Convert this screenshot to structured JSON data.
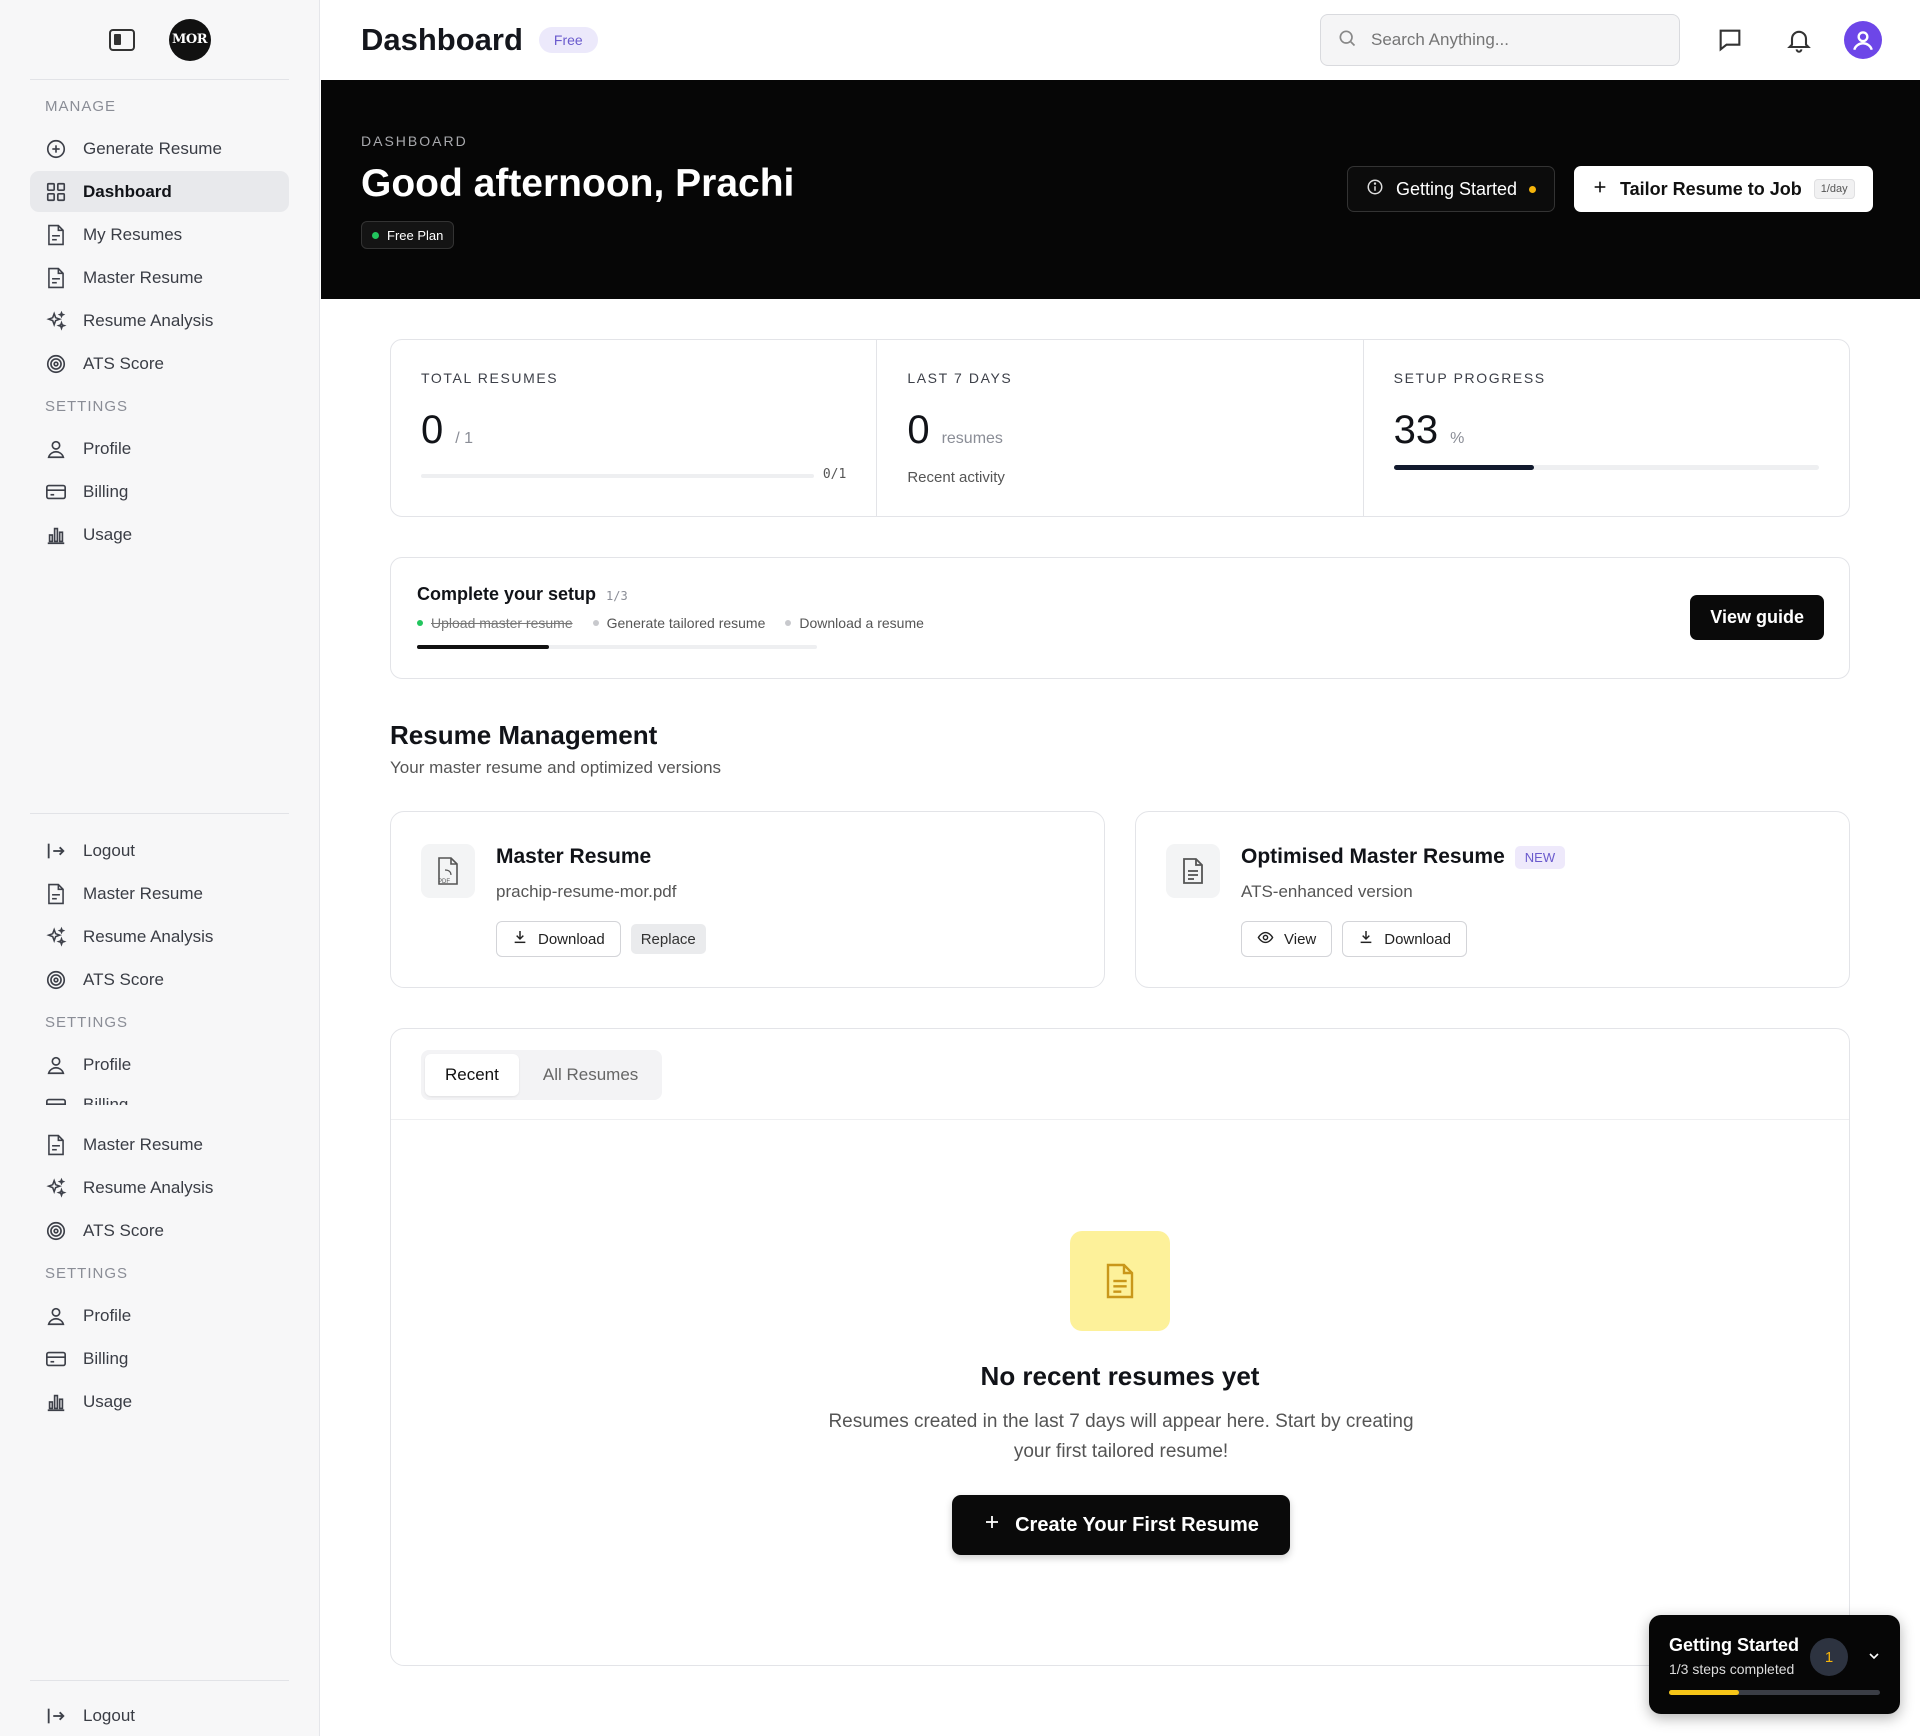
{
  "app": {
    "logo_text": "MOR"
  },
  "sidebar": {
    "groups": [
      {
        "section": "MANAGE",
        "items": [
          {
            "label": "Generate Resume",
            "icon": "plus-circle-icon"
          },
          {
            "label": "Dashboard",
            "icon": "grid-icon",
            "active": true
          },
          {
            "label": "My Resumes",
            "icon": "document-icon"
          },
          {
            "label": "Master Resume",
            "icon": "document-icon"
          },
          {
            "label": "Resume Analysis",
            "icon": "sparkles-icon"
          },
          {
            "label": "ATS Score",
            "icon": "target-icon"
          }
        ]
      },
      {
        "section": "SETTINGS",
        "items": [
          {
            "label": "Profile",
            "icon": "user-icon"
          },
          {
            "label": "Billing",
            "icon": "credit-card-icon"
          },
          {
            "label": "Usage",
            "icon": "bar-chart-icon"
          }
        ]
      }
    ],
    "duplicate_a": [
      {
        "label": "Logout",
        "icon": "logout-icon"
      },
      {
        "label": "Master Resume",
        "icon": "document-icon"
      },
      {
        "label": "Resume Analysis",
        "icon": "sparkles-icon"
      },
      {
        "label": "ATS Score",
        "icon": "target-icon"
      }
    ],
    "duplicate_a_section": "SETTINGS",
    "duplicate_a_settings": [
      {
        "label": "Profile",
        "icon": "user-icon"
      },
      {
        "label": "Billing",
        "icon": "credit-card-icon"
      }
    ],
    "duplicate_b": [
      {
        "label": "Master Resume",
        "icon": "document-icon"
      },
      {
        "label": "Resume Analysis",
        "icon": "sparkles-icon"
      },
      {
        "label": "ATS Score",
        "icon": "target-icon"
      }
    ],
    "duplicate_b_section": "SETTINGS",
    "duplicate_b_settings": [
      {
        "label": "Profile",
        "icon": "user-icon"
      },
      {
        "label": "Billing",
        "icon": "credit-card-icon"
      },
      {
        "label": "Usage",
        "icon": "bar-chart-icon"
      }
    ],
    "logout_label": "Logout"
  },
  "header": {
    "title": "Dashboard",
    "plan_badge": "Free",
    "search_placeholder": "Search Anything..."
  },
  "hero": {
    "eyebrow": "DASHBOARD",
    "greeting": "Good afternoon, Prachi",
    "plan_pill": "Free Plan",
    "getting_started_label": "Getting Started",
    "tailor_label": "Tailor Resume to Job",
    "tailor_rate": "1/day"
  },
  "stats": {
    "total": {
      "label": "TOTAL RESUMES",
      "value": "0",
      "sub": "/ 1",
      "bar_text": "0/1",
      "fraction": 0
    },
    "week": {
      "label": "LAST 7 DAYS",
      "value": "0",
      "sub": "resumes",
      "caption": "Recent activity"
    },
    "setup": {
      "label": "SETUP PROGRESS",
      "value": "33",
      "sub": "%",
      "percent": 33
    }
  },
  "setup_card": {
    "title": "Complete your setup",
    "count": "1/3",
    "steps": [
      {
        "label": "Upload master resume",
        "done": true
      },
      {
        "label": "Generate tailored resume",
        "done": false
      },
      {
        "label": "Download a resume",
        "done": false
      }
    ],
    "progress_fraction": 0.33,
    "guide_button": "View guide"
  },
  "resume_management": {
    "title": "Resume Management",
    "subtitle": "Your master resume and optimized versions",
    "master": {
      "title": "Master Resume",
      "filename": "prachip-resume-mor.pdf",
      "download_label": "Download",
      "replace_label": "Replace",
      "icon_text": "PDF"
    },
    "optimised": {
      "title": "Optimised Master Resume",
      "badge": "NEW",
      "subtitle": "ATS-enhanced version",
      "view_label": "View",
      "download_label": "Download"
    }
  },
  "recent": {
    "tabs": [
      "Recent",
      "All Resumes"
    ],
    "active_tab": "Recent",
    "empty_title": "No recent resumes yet",
    "empty_text": "Resumes created in the last 7 days will appear here. Start by creating your first tailored resume!",
    "create_button": "Create Your First Resume"
  },
  "floating": {
    "title": "Getting Started",
    "subtitle": "1/3 steps completed",
    "count": "1",
    "progress_fraction": 0.33
  },
  "colors": {
    "accent_purple": "#6d46e8",
    "badge_purple": "#6a5acd",
    "green": "#22c55e",
    "amber": "#f5b40b",
    "hero_bg": "#060606",
    "empty_icon_bg": "#fdf19a"
  }
}
